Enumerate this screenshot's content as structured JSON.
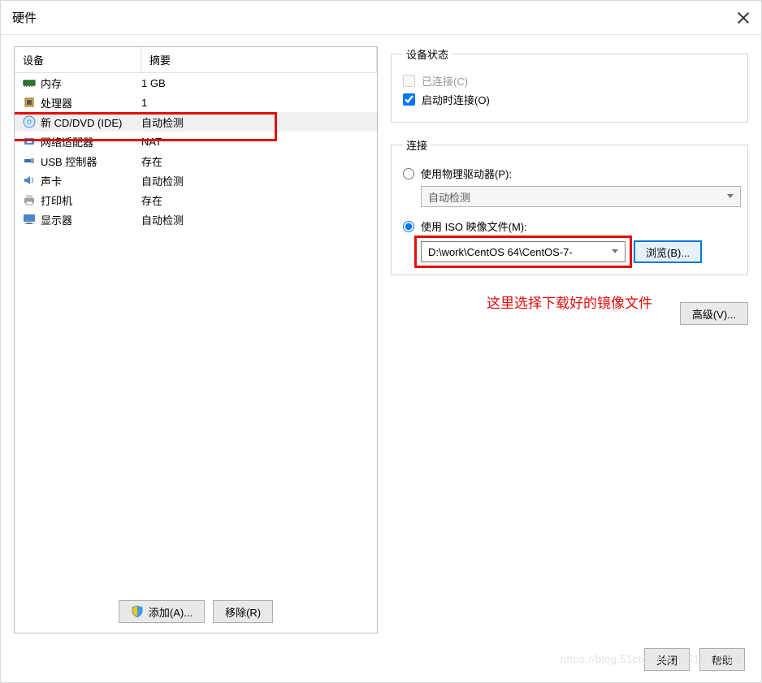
{
  "window": {
    "title": "硬件"
  },
  "columns": {
    "device": "设备",
    "summary": "摘要"
  },
  "devices": [
    {
      "icon": "memory-icon",
      "name": "内存",
      "summary": "1 GB",
      "selected": false
    },
    {
      "icon": "cpu-icon",
      "name": "处理器",
      "summary": "1",
      "selected": false
    },
    {
      "icon": "disc-icon",
      "name": "新 CD/DVD (IDE)",
      "summary": "自动检测",
      "selected": true
    },
    {
      "icon": "network-icon",
      "name": "网络适配器",
      "summary": "NAT",
      "selected": false
    },
    {
      "icon": "usb-icon",
      "name": "USB 控制器",
      "summary": "存在",
      "selected": false
    },
    {
      "icon": "sound-icon",
      "name": "声卡",
      "summary": "自动检测",
      "selected": false
    },
    {
      "icon": "printer-icon",
      "name": "打印机",
      "summary": "存在",
      "selected": false
    },
    {
      "icon": "display-icon",
      "name": "显示器",
      "summary": "自动检测",
      "selected": false
    }
  ],
  "leftButtons": {
    "add": "添加(A)...",
    "remove": "移除(R)"
  },
  "status": {
    "legend": "设备状态",
    "connected": {
      "label": "已连接(C)",
      "checked": false,
      "disabled": true
    },
    "connectAtPowerOn": {
      "label": "启动时连接(O)",
      "checked": true,
      "disabled": false
    }
  },
  "connection": {
    "legend": "连接",
    "physical": {
      "label": "使用物理驱动器(P):",
      "selected": false,
      "value": "自动检测"
    },
    "iso": {
      "label": "使用 ISO 映像文件(M):",
      "selected": true,
      "path": "D:\\work\\CentOS 64\\CentOS-7-"
    },
    "browse": "浏览(B)...",
    "advanced": "高级(V)..."
  },
  "hint": "这里选择下载好的镜像文件",
  "footer": {
    "close": "关闭",
    "help": "帮助"
  },
  "watermark": "https://blog.51cto.com @51CTO博客"
}
